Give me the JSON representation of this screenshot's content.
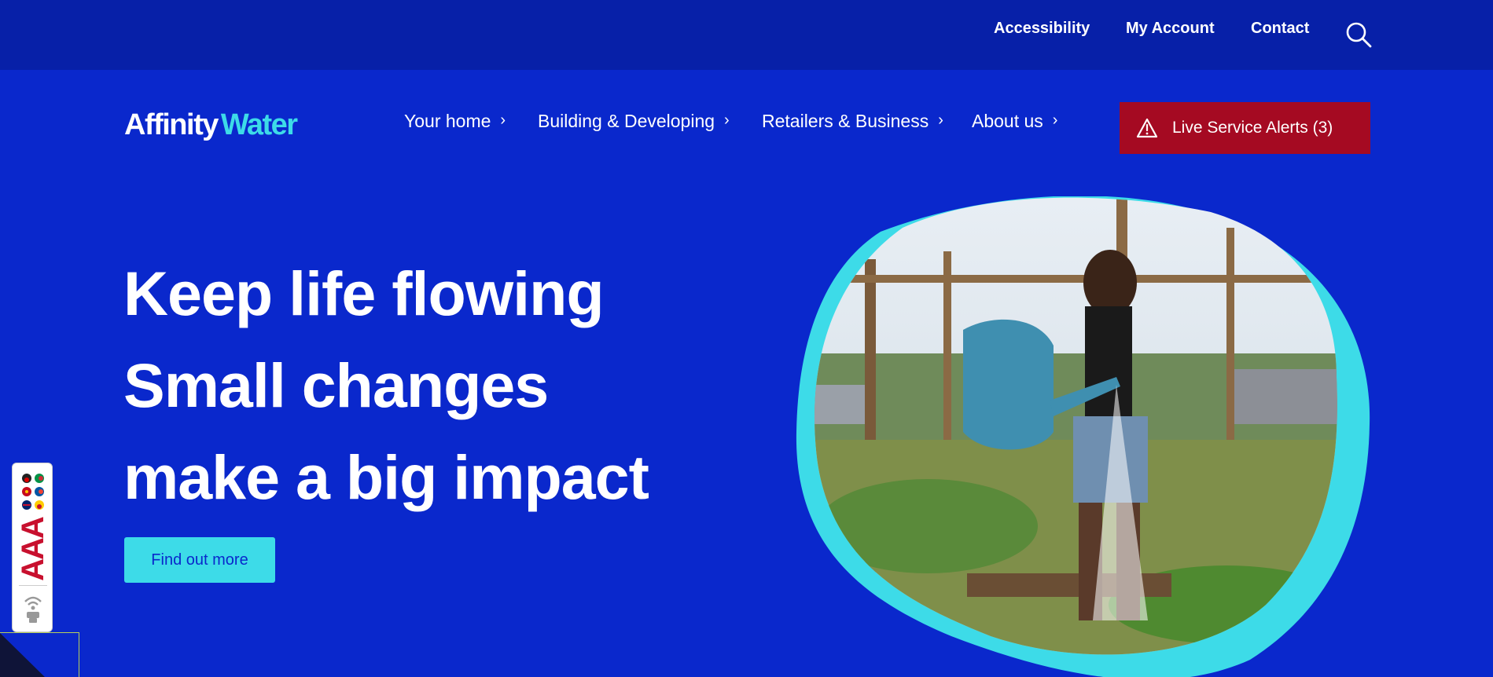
{
  "top_nav": {
    "links": [
      "Accessibility",
      "My Account",
      "Contact"
    ],
    "search_icon": "search-icon"
  },
  "logo": {
    "part1": "Affinity",
    "part2": "Water"
  },
  "main_nav": {
    "items": [
      "Your home",
      "Building & Developing",
      "Retailers & Business",
      "About us"
    ],
    "chevron": "›"
  },
  "alert_button": {
    "label": "Live Service Alerts (3)",
    "icon": "warning-triangle-icon"
  },
  "hero": {
    "lines": [
      "Keep life flowing",
      "Small changes",
      "make a big impact"
    ],
    "cta_label": "Find out more",
    "image_description": "woman-watering-allotment-photo"
  },
  "a11y_widget": {
    "label": "AAA",
    "icons": [
      "language-flags-icon",
      "text-size-icon",
      "speaker-icon"
    ]
  },
  "colors": {
    "page_bg": "#0a28cc",
    "topbar_bg": "#0720a8",
    "accent_cyan": "#3ddbe8",
    "alert_red": "#a50a22",
    "text": "#ffffff"
  }
}
